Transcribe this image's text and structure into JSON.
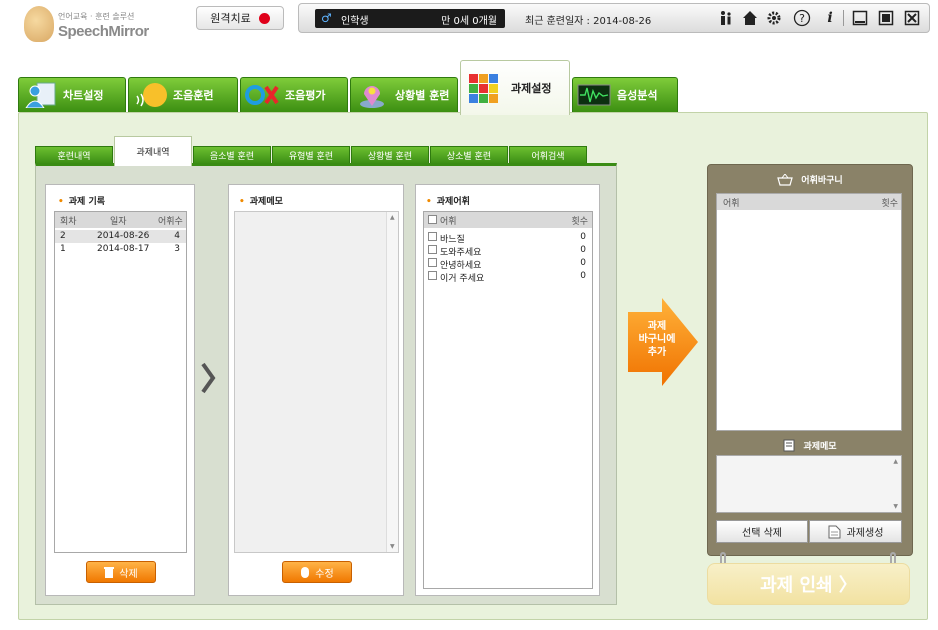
{
  "app": {
    "logo_subtitle": "언어교육 · 훈련 솔루션",
    "logo_name": "SpeechMirror"
  },
  "topbar": {
    "remote_label": "원격치료",
    "patient_name": "인학생",
    "patient_age": "만 0세 0개월",
    "last_training": "최근 훈련일자 : 2014-08-26",
    "icons": [
      "person-icon",
      "home-icon",
      "gear-icon",
      "help-icon",
      "info-icon",
      "minimize-icon",
      "restore-icon",
      "close-icon"
    ]
  },
  "main_tabs": [
    {
      "label": "차트설정",
      "icon": "person-icon"
    },
    {
      "label": "조음훈련",
      "icon": "face-icon"
    },
    {
      "label": "조음평가",
      "icon": "ox-icon"
    },
    {
      "label": "상황별 훈련",
      "icon": "map-pin-icon"
    },
    {
      "label": "과제설정",
      "icon": "cube-icon"
    },
    {
      "label": "음성분석",
      "icon": "waveform-icon"
    }
  ],
  "sub_tabs": [
    {
      "label": "훈련내역"
    },
    {
      "label": "과제내역"
    },
    {
      "label": "음소별 훈련"
    },
    {
      "label": "유형별 훈련"
    },
    {
      "label": "상황별 훈련"
    },
    {
      "label": "상소별 훈련"
    },
    {
      "label": "어휘검색"
    }
  ],
  "task_records": {
    "title": "과제 기록",
    "columns": [
      "회차",
      "일자",
      "어휘수"
    ],
    "rows": [
      {
        "round": "2",
        "date": "2014-08-26",
        "count": "4"
      },
      {
        "round": "1",
        "date": "2014-08-17",
        "count": "3"
      }
    ],
    "delete_label": "삭제"
  },
  "task_memo": {
    "title": "과제메모",
    "edit_label": "수정"
  },
  "task_vocab": {
    "title": "과제어휘",
    "columns": [
      "어휘",
      "횟수"
    ],
    "rows": [
      {
        "word": "바느질",
        "count": "0"
      },
      {
        "word": "도와주세요",
        "count": "0"
      },
      {
        "word": "안녕하세요",
        "count": "0"
      },
      {
        "word": "이거 주세요",
        "count": "0"
      }
    ]
  },
  "add_to_basket": {
    "line1": "과제",
    "line2": "바구니에",
    "line3": "추가"
  },
  "basket": {
    "title": "어휘바구니",
    "columns": [
      "어휘",
      "횟수"
    ],
    "memo_title": "과제메모",
    "delete_selected_label": "선택 삭제",
    "create_task_label": "과제생성"
  },
  "print_label": "과제 인쇄 〉",
  "colors": {
    "tab_green": "#4fa61e",
    "orange": "#f07800",
    "record_dot": "#e0001a",
    "basket_brown": "#8a8268"
  }
}
